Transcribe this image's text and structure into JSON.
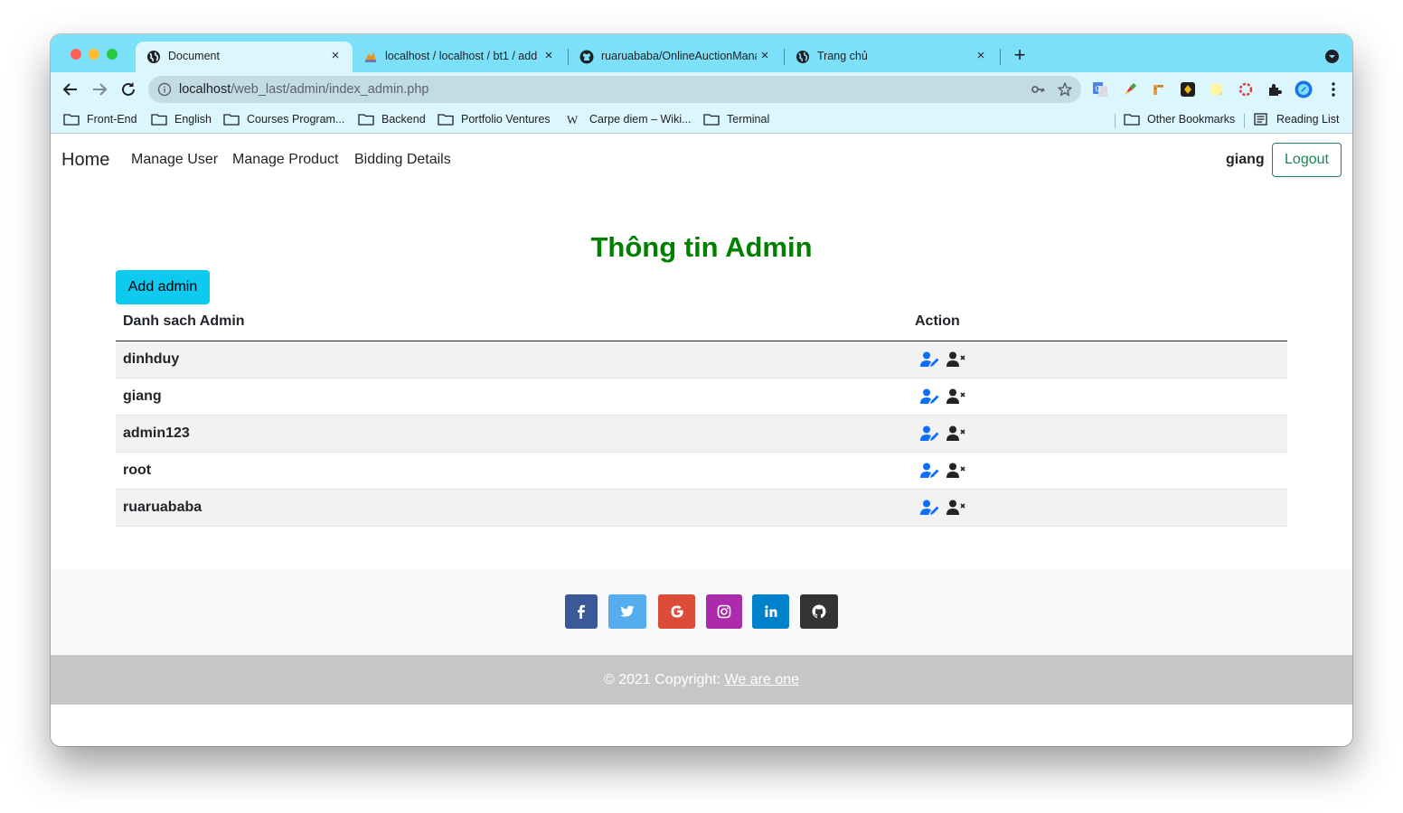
{
  "browser": {
    "tabs": [
      {
        "title": "Document",
        "active": true
      },
      {
        "title": "localhost / localhost / bt1 / add",
        "active": false
      },
      {
        "title": "ruaruababa/OnlineAuctionMana",
        "active": false
      },
      {
        "title": "Trang chủ",
        "active": false
      }
    ],
    "new_tab": "+",
    "close_glyph": "×",
    "url_host": "localhost",
    "url_path": "/web_last/admin/index_admin.php",
    "bookmarks": [
      "Front-End",
      "English",
      "Courses Program...",
      "Backend",
      "Portfolio Ventures",
      "Carpe diem – Wiki...",
      "Terminal"
    ],
    "bookmarks_right": [
      "Other Bookmarks",
      "Reading List"
    ],
    "accent_color": "#7ce0fb"
  },
  "navbar": {
    "brand": "Home",
    "links": [
      "Manage User",
      "Manage Product",
      "Bidding Details"
    ],
    "username": "giang",
    "logout": "Logout"
  },
  "main": {
    "title": "Thông tin Admin",
    "add_button": "Add admin",
    "table": {
      "headers": [
        "Danh sach Admin",
        "Action"
      ],
      "rows": [
        "dinhduy",
        "giang",
        "admin123",
        "root",
        "ruaruababa"
      ]
    }
  },
  "footer": {
    "social": [
      {
        "icon": "facebook-icon",
        "color": "#3b5998"
      },
      {
        "icon": "twitter-icon",
        "color": "#55acee"
      },
      {
        "icon": "google-icon",
        "color": "#dd4b39"
      },
      {
        "icon": "instagram-icon",
        "color": "#ac2bac"
      },
      {
        "icon": "linkedin-icon",
        "color": "#0082ca"
      },
      {
        "icon": "github-icon",
        "color": "#333333"
      }
    ],
    "copyright": "© 2021 Copyright: ",
    "copyright_link": "We are one"
  }
}
